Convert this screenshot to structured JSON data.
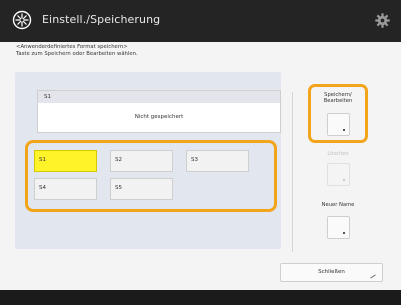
{
  "titlebar": {
    "title": "Einstell./Speicherung"
  },
  "instruction": {
    "line1": "<Anwenderdefiniertes Format speichern>",
    "line2": "Taste zum Speichern oder Bearbeiten wählen."
  },
  "selected_slot": {
    "label": "S1",
    "status": "Nicht gespeichert"
  },
  "slots": [
    {
      "label": "S1",
      "selected": true
    },
    {
      "label": "S2",
      "selected": false
    },
    {
      "label": "S3",
      "selected": false
    },
    {
      "label": "S4",
      "selected": false
    },
    {
      "label": "S5",
      "selected": false
    }
  ],
  "buttons": {
    "store_edit": {
      "line1": "Speichern/",
      "line2": "Bearbeiten"
    },
    "delete": "Löschen",
    "rename": "Neuer Name",
    "close": "Schließen"
  },
  "colors": {
    "highlight_ring": "#f2a51a",
    "selected_slot": "#fff42a",
    "titlebar": "#242424"
  }
}
